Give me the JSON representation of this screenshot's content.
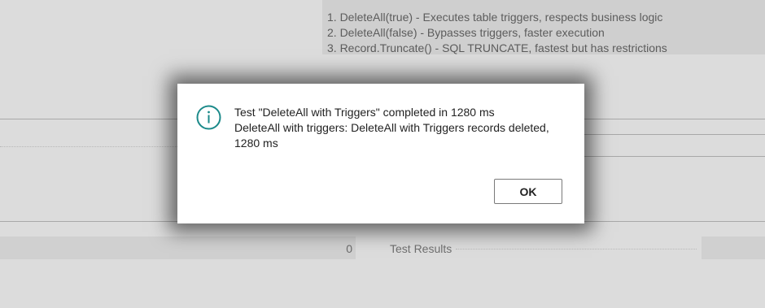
{
  "background": {
    "info_lines": [
      "1. DeleteAll(true) - Executes table triggers, respects business logic",
      "2. DeleteAll(false) - Bypasses triggers, faster execution",
      "3. Record.Truncate() - SQL TRUNCATE, fastest but has restrictions"
    ],
    "results_count": "0",
    "results_label": "Test Results"
  },
  "dialog": {
    "icon": "info-circle-icon",
    "line1": "Test \"DeleteAll with Triggers\" completed in 1280 ms",
    "line2": "DeleteAll with triggers: DeleteAll with Triggers records deleted, 1280 ms",
    "ok_label": "OK"
  },
  "colors": {
    "icon_teal": "#1c8a8a",
    "overlay_bg": "#dcdcdc",
    "dialog_bg": "#ffffff"
  }
}
